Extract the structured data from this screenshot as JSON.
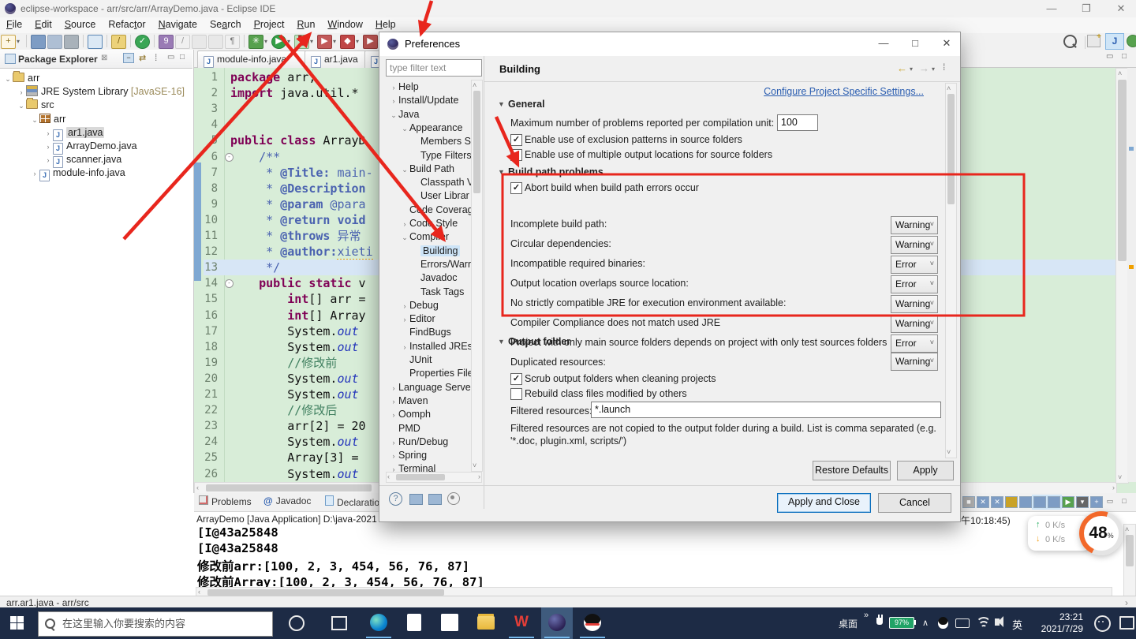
{
  "window": {
    "title": "eclipse-workspace - arr/src/arr/ArrayDemo.java - Eclipse IDE"
  },
  "menu": {
    "items": [
      {
        "label": "File",
        "u": 0
      },
      {
        "label": "Edit",
        "u": 0
      },
      {
        "label": "Source",
        "u": 0
      },
      {
        "label": "Refactor",
        "u": 5
      },
      {
        "label": "Navigate",
        "u": 0
      },
      {
        "label": "Search",
        "u": 2
      },
      {
        "label": "Project",
        "u": 0
      },
      {
        "label": "Run",
        "u": 0
      },
      {
        "label": "Window",
        "u": 0
      },
      {
        "label": "Help",
        "u": 0
      }
    ]
  },
  "toolbar": {
    "left_icons": [
      {
        "name": "new-wizard-icon",
        "glyph": "+",
        "color": "#8a6d1f",
        "bg": "#fdf6e3",
        "border": "#c9a64d",
        "dd": true
      },
      {
        "name": "sep",
        "sep": true
      },
      {
        "name": "save-icon",
        "glyph": "",
        "color": "#fff",
        "bg": "#7d9cc4",
        "border": "#5d7da6"
      },
      {
        "name": "save-all-icon",
        "glyph": "",
        "color": "#fff",
        "bg": "#aebfd4",
        "border": "#9aa9bd"
      },
      {
        "name": "print-icon",
        "glyph": "",
        "color": "#fff",
        "bg": "#a9b2ba",
        "border": "#8b949c"
      },
      {
        "name": "sep",
        "sep": true
      },
      {
        "name": "console-monitor-icon",
        "glyph": "",
        "color": "#fff",
        "bg": "#dce9f5",
        "border": "#5b87b5"
      },
      {
        "name": "sep",
        "sep": true
      },
      {
        "name": "search-flashlight-icon",
        "glyph": "/",
        "color": "#7a5c12",
        "bg": "#ecd27a",
        "border": "#b99c3e"
      },
      {
        "name": "sep",
        "sep": true
      },
      {
        "name": "build-check-icon",
        "glyph": "✓",
        "color": "#fff",
        "bg": "#3aa655",
        "border": "#2c8443",
        "round": true
      },
      {
        "name": "sep",
        "sep": true
      },
      {
        "name": "mark-occurrences-icon",
        "glyph": "9",
        "color": "#fff",
        "bg": "#9a7bb5",
        "border": "#7c5f96"
      },
      {
        "name": "ascii-art-icon",
        "glyph": "/",
        "color": "#999",
        "bg": "#f0f0f0",
        "border": "#cfcfcf"
      },
      {
        "name": "copy-docs-icon",
        "glyph": "",
        "color": "#999",
        "bg": "#e8e8e8",
        "border": "#cfcfcf"
      },
      {
        "name": "doc-icon",
        "glyph": "",
        "color": "#999",
        "bg": "#e8e8e8",
        "border": "#cfcfcf"
      },
      {
        "name": "show-whitespace-icon",
        "glyph": "¶",
        "color": "#777",
        "bg": "#f0f0f0",
        "border": "#cfcfcf"
      },
      {
        "name": "sep",
        "sep": true
      },
      {
        "name": "debug-icon",
        "glyph": "✳",
        "color": "#fff",
        "bg": "#57a14e",
        "border": "#3f7f3a",
        "dd": true
      },
      {
        "name": "run-icon",
        "glyph": "▶",
        "color": "#fff",
        "bg": "#34a046",
        "border": "#27803a",
        "round": true,
        "dd": true
      },
      {
        "name": "coverage-icon",
        "glyph": "▚",
        "color": "#b02a2a",
        "bg": "#bfe3bf",
        "border": "#7fae7f",
        "dd": true
      },
      {
        "name": "run-external-icon",
        "glyph": "▶",
        "color": "#fff",
        "bg": "#c25959",
        "border": "#9a3f3f",
        "dd": true
      },
      {
        "name": "profile-icon",
        "glyph": "◆",
        "color": "#fff",
        "bg": "#c04747",
        "border": "#993232",
        "dd": true
      },
      {
        "name": "stop-icon",
        "glyph": "▶",
        "color": "#fff",
        "bg": "#b5524f",
        "border": "#8f3a38",
        "dd": true
      },
      {
        "name": "sep",
        "sep": true
      },
      {
        "name": "new-java-project-icon",
        "glyph": "▦",
        "color": "#fff",
        "bg": "#b0794c",
        "border": "#8a5c33",
        "dd": true
      },
      {
        "name": "open-task-icon",
        "glyph": "G",
        "color": "#fff",
        "bg": "#d98f2b",
        "border": "#ad6f1d",
        "dd": true
      }
    ]
  },
  "package_explorer": {
    "title": "Package Explorer",
    "tree": [
      {
        "label": "arr",
        "level": 0,
        "expander": "v",
        "icon": "project"
      },
      {
        "label": "JRE System Library ",
        "suffix": "[JavaSE-16]",
        "level": 1,
        "expander": ">",
        "icon": "library"
      },
      {
        "label": "src",
        "level": 1,
        "expander": "v",
        "icon": "src-folder"
      },
      {
        "label": "arr",
        "level": 2,
        "expander": "v",
        "icon": "package"
      },
      {
        "label": "ar1.java",
        "level": 3,
        "expander": ">",
        "icon": "java-file",
        "selected": true
      },
      {
        "label": "ArrayDemo.java",
        "level": 3,
        "expander": ">",
        "icon": "java-file"
      },
      {
        "label": "scanner.java",
        "level": 3,
        "expander": ">",
        "icon": "java-file"
      },
      {
        "label": "module-info.java",
        "level": 2,
        "expander": ">",
        "icon": "java-file"
      }
    ]
  },
  "editor": {
    "tabs": [
      {
        "label": "module-info.java"
      },
      {
        "label": "ar1.java"
      },
      {
        "label": "*"
      }
    ],
    "lines": [
      {
        "n": 1,
        "segs": [
          [
            "k",
            "package"
          ],
          [
            "p",
            " arr;"
          ]
        ]
      },
      {
        "n": 2,
        "segs": [
          [
            "k",
            "import"
          ],
          [
            "p",
            " java.util.*"
          ]
        ]
      },
      {
        "n": 3,
        "segs": []
      },
      {
        "n": 4,
        "segs": []
      },
      {
        "n": 5,
        "segs": [
          [
            "k",
            "public"
          ],
          [
            "p",
            " "
          ],
          [
            "k",
            "class"
          ],
          [
            "p",
            " ArrayD"
          ]
        ]
      },
      {
        "n": 6,
        "segs": [
          [
            "jd",
            "    /**"
          ]
        ],
        "fold": true
      },
      {
        "n": 7,
        "segs": [
          [
            "jd",
            "     * "
          ],
          [
            "jt",
            "@Title:"
          ],
          [
            "jd",
            " main-"
          ]
        ]
      },
      {
        "n": 8,
        "segs": [
          [
            "jd",
            "     * "
          ],
          [
            "jt",
            "@Description"
          ]
        ]
      },
      {
        "n": 9,
        "segs": [
          [
            "jd",
            "     * "
          ],
          [
            "jt",
            "@param"
          ],
          [
            "jd",
            " @para"
          ]
        ]
      },
      {
        "n": 10,
        "segs": [
          [
            "jd",
            "     * "
          ],
          [
            "jt",
            "@return"
          ],
          [
            "jt",
            " void"
          ]
        ]
      },
      {
        "n": 11,
        "segs": [
          [
            "jd",
            "     * "
          ],
          [
            "jt",
            "@throws"
          ],
          [
            "jd",
            " 异常"
          ]
        ]
      },
      {
        "n": 12,
        "segs": [
          [
            "jd",
            "     * "
          ],
          [
            "jt",
            "@author:"
          ],
          [
            "sq",
            "xieti"
          ]
        ]
      },
      {
        "n": 13,
        "segs": [
          [
            "jd",
            "     */"
          ]
        ],
        "current": true
      },
      {
        "n": 14,
        "segs": [
          [
            "p",
            "    "
          ],
          [
            "k",
            "public"
          ],
          [
            "p",
            " "
          ],
          [
            "k",
            "static"
          ],
          [
            "p",
            " v"
          ]
        ],
        "fold": true
      },
      {
        "n": 15,
        "segs": [
          [
            "p",
            "        "
          ],
          [
            "k",
            "int"
          ],
          [
            "p",
            "[] arr ="
          ]
        ]
      },
      {
        "n": 16,
        "segs": [
          [
            "p",
            "        "
          ],
          [
            "k",
            "int"
          ],
          [
            "p",
            "[] Array"
          ]
        ]
      },
      {
        "n": 17,
        "segs": [
          [
            "p",
            "        System."
          ],
          [
            "it",
            "out"
          ]
        ]
      },
      {
        "n": 18,
        "segs": [
          [
            "p",
            "        System."
          ],
          [
            "it",
            "out"
          ]
        ]
      },
      {
        "n": 19,
        "segs": [
          [
            "p",
            "        "
          ],
          [
            "cm",
            "//修改前"
          ]
        ]
      },
      {
        "n": 20,
        "segs": [
          [
            "p",
            "        System."
          ],
          [
            "it",
            "out"
          ]
        ]
      },
      {
        "n": 21,
        "segs": [
          [
            "p",
            "        System."
          ],
          [
            "it",
            "out"
          ]
        ]
      },
      {
        "n": 22,
        "segs": [
          [
            "p",
            "        "
          ],
          [
            "cm",
            "//修改后"
          ]
        ]
      },
      {
        "n": 23,
        "segs": [
          [
            "p",
            "        arr[2] = 20"
          ]
        ]
      },
      {
        "n": 24,
        "segs": [
          [
            "p",
            "        System."
          ],
          [
            "it",
            "out"
          ]
        ]
      },
      {
        "n": 25,
        "segs": [
          [
            "p",
            "        Array[3] ="
          ]
        ]
      },
      {
        "n": 26,
        "segs": [
          [
            "p",
            "        System."
          ],
          [
            "it",
            "out"
          ]
        ]
      }
    ]
  },
  "console": {
    "tabs": [
      {
        "label": "Problems",
        "icon": "problems-icon"
      },
      {
        "label": "Javadoc",
        "icon": "javadoc-icon"
      },
      {
        "label": "Declaration",
        "icon": "declaration-icon"
      }
    ],
    "title_left": "ArrayDemo [Java Application] D:\\java-2021",
    "fragment_right": "午10:18:45)",
    "output": [
      "[I@43a25848",
      "[I@43a25848",
      "修改前arr:[100, 2, 3, 454, 56, 76, 87]",
      "修改前Array:[100, 2, 3, 454, 56, 76, 87]"
    ]
  },
  "status_bar": {
    "text": "arr.ar1.java - arr/src"
  },
  "prefs": {
    "title": "Preferences",
    "filter_placeholder": "type filter text",
    "heading": "Building",
    "link": "Configure Project Specific Settings...",
    "tree": [
      {
        "label": "Help",
        "level": 0,
        "expander": ">"
      },
      {
        "label": "Install/Update",
        "level": 0,
        "expander": ">"
      },
      {
        "label": "Java",
        "level": 0,
        "expander": "v"
      },
      {
        "label": "Appearance",
        "level": 1,
        "expander": "v"
      },
      {
        "label": "Members S",
        "level": 2,
        "expander": ""
      },
      {
        "label": "Type Filters",
        "level": 2,
        "expander": ""
      },
      {
        "label": "Build Path",
        "level": 1,
        "expander": "v"
      },
      {
        "label": "Classpath V",
        "level": 2,
        "expander": ""
      },
      {
        "label": "User Librar",
        "level": 2,
        "expander": ""
      },
      {
        "label": "Code Coverag",
        "level": 1,
        "expander": ""
      },
      {
        "label": "Code Style",
        "level": 1,
        "expander": ">"
      },
      {
        "label": "Compiler",
        "level": 1,
        "expander": "v"
      },
      {
        "label": "Building",
        "level": 2,
        "expander": "",
        "selected": true
      },
      {
        "label": "Errors/Warn",
        "level": 2,
        "expander": ""
      },
      {
        "label": "Javadoc",
        "level": 2,
        "expander": ""
      },
      {
        "label": "Task Tags",
        "level": 2,
        "expander": ""
      },
      {
        "label": "Debug",
        "level": 1,
        "expander": ">"
      },
      {
        "label": "Editor",
        "level": 1,
        "expander": ">"
      },
      {
        "label": "FindBugs",
        "level": 1,
        "expander": ""
      },
      {
        "label": "Installed JREs",
        "level": 1,
        "expander": ">"
      },
      {
        "label": "JUnit",
        "level": 1,
        "expander": ""
      },
      {
        "label": "Properties File",
        "level": 1,
        "expander": ""
      },
      {
        "label": "Language Server",
        "level": 0,
        "expander": ">"
      },
      {
        "label": "Maven",
        "level": 0,
        "expander": ">"
      },
      {
        "label": "Oomph",
        "level": 0,
        "expander": ">"
      },
      {
        "label": "PMD",
        "level": 0,
        "expander": ""
      },
      {
        "label": "Run/Debug",
        "level": 0,
        "expander": ">"
      },
      {
        "label": "Spring",
        "level": 0,
        "expander": ">"
      },
      {
        "label": "Terminal",
        "level": 0,
        "expander": ">"
      }
    ],
    "general": {
      "header": "General",
      "max_label": "Maximum number of problems reported per compilation unit:",
      "max_value": "100",
      "cb_exclusion": "Enable use of exclusion patterns in source folders",
      "cb_multiple": "Enable use of multiple output locations for source folders"
    },
    "build_path_problems": {
      "header": "Build path problems",
      "abort_label": "Abort build when build path errors occur",
      "rows": [
        {
          "label": "Incomplete build path:",
          "value": "Warning"
        },
        {
          "label": "Circular dependencies:",
          "value": "Warning"
        },
        {
          "label": "Incompatible required binaries:",
          "value": "Error"
        },
        {
          "label": "Output location overlaps source location:",
          "value": "Error"
        },
        {
          "label": "No strictly compatible JRE for execution environment available:",
          "value": "Warning"
        },
        {
          "label": "Compiler Compliance does not match used JRE",
          "value": "Warning"
        },
        {
          "label": "Project with only main source folders depends on project with only test sources folders",
          "value": "Error"
        }
      ]
    },
    "output_folder": {
      "header": "Output folder",
      "dup_label": "Duplicated resources:",
      "dup_value": "Warning",
      "cb_scrub": "Scrub output folders when cleaning projects",
      "cb_rebuild": "Rebuild class files modified by others",
      "filtered_label": "Filtered resources:",
      "filtered_value": "*.launch",
      "note": "Filtered resources are not copied to the output folder during a build. List is comma separated (e.g. '*.doc, plugin.xml, scripts/')"
    },
    "buttons": {
      "restore": "Restore Defaults",
      "apply": "Apply",
      "apply_close": "Apply and Close",
      "cancel": "Cancel"
    }
  },
  "taskbar": {
    "search_placeholder": "在这里输入你要搜索的内容",
    "apps": [
      "edge",
      "word",
      "store",
      "explorer",
      "wps",
      "eclipse",
      "qq"
    ],
    "tray": {
      "desktop_label": "桌面",
      "battery": "97%",
      "lang": "英",
      "time": "23:21",
      "date": "2021/7/29"
    }
  },
  "widgets": {
    "net_up": "0 K/s",
    "net_down": "0 K/s",
    "cpu_value": "48",
    "cpu_unit": "%"
  }
}
